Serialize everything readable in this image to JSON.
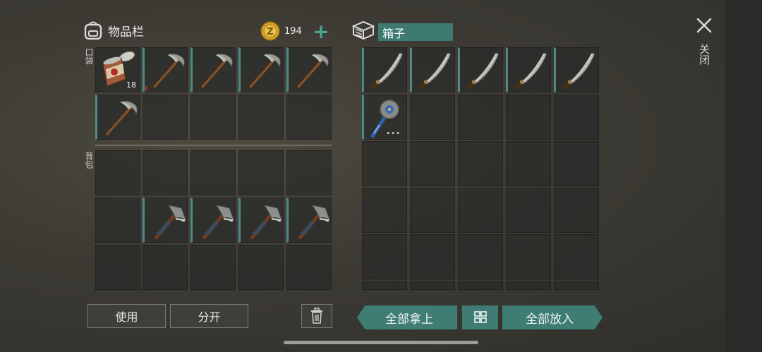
{
  "inventory": {
    "title": "物品栏",
    "icon": "backpack-icon"
  },
  "currency": {
    "amount": "194",
    "icon": "coin-icon",
    "add_label": "+"
  },
  "pockets": {
    "label": "口袋",
    "slots": [
      {
        "item": "canned-food",
        "count": "18"
      },
      {
        "item": "pickaxe",
        "durability_low": true
      },
      {
        "item": "pickaxe"
      },
      {
        "item": "pickaxe"
      },
      {
        "item": "pickaxe"
      },
      {
        "item": "pickaxe"
      },
      {
        "item": ""
      },
      {
        "item": ""
      },
      {
        "item": ""
      },
      {
        "item": ""
      }
    ]
  },
  "backpack": {
    "label": "背包",
    "slots": [
      {
        "item": ""
      },
      {
        "item": ""
      },
      {
        "item": ""
      },
      {
        "item": ""
      },
      {
        "item": ""
      },
      {
        "item": ""
      },
      {
        "item": "hatchet"
      },
      {
        "item": "hatchet"
      },
      {
        "item": "hatchet"
      },
      {
        "item": "hatchet"
      },
      {
        "item": ""
      },
      {
        "item": ""
      },
      {
        "item": ""
      },
      {
        "item": ""
      },
      {
        "item": ""
      }
    ]
  },
  "box": {
    "title": "箱子",
    "icon": "crate-icon",
    "slots": [
      {
        "item": "machete"
      },
      {
        "item": "machete"
      },
      {
        "item": "machete"
      },
      {
        "item": "machete"
      },
      {
        "item": "machete"
      },
      {
        "item": "saw-mace",
        "more": "•••"
      }
    ]
  },
  "buttons": {
    "use": "使用",
    "split": "分开",
    "take_all": "全部拿上",
    "put_all": "全部放入",
    "sort": "sort-icon",
    "trash": "trash-icon"
  },
  "close": {
    "label": "关闭",
    "icon": "close-icon"
  },
  "colors": {
    "accent": "#3f7c74",
    "slot_marker": "#4a8a8a"
  }
}
